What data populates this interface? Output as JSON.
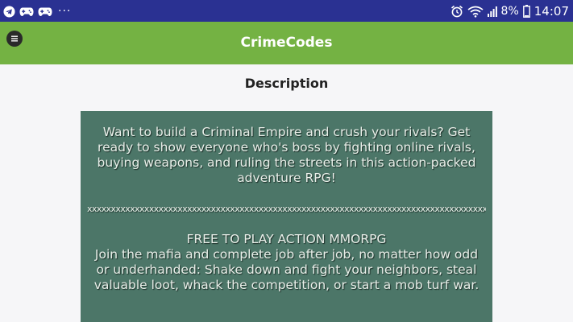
{
  "status_bar": {
    "left_icons": [
      "telegram-icon",
      "gamepad-icon",
      "gamepad-icon",
      "more-dots-icon"
    ],
    "more_dots": "···",
    "battery_percent": "8%",
    "time": "14:07",
    "right_icons": [
      "alarm-icon",
      "wifi-icon",
      "signal-icon",
      "battery-icon"
    ]
  },
  "app_bar": {
    "title": "CrimeCodes",
    "menu_icon": "menu-icon",
    "background_color": "#74b243"
  },
  "content": {
    "heading": "Description",
    "card_color": "#4c7668",
    "paragraphs": {
      "intro": "Want to build a Criminal Empire and crush your rivals? Get ready to show everyone who's boss by fighting online rivals, buying weapons, and ruling the streets in this action-packed adventure RPG!",
      "divider": "xxxxxxxxxxxxxxxxxxxxxxxxxxxxxxxxxxxxxxxxxxxxxxxxxxxxxxxxxxxxxxxxxxxxxxxxxxxxxxxxxxxxxxxxxxxxxxxxxxxxx",
      "subheading": "FREE TO PLAY ACTION MMORPG",
      "body": "Join the mafia and complete job after job, no matter how odd or underhanded: Shake down and fight your neighbors, steal valuable loot, whack the competition, or start a mob turf war."
    }
  }
}
